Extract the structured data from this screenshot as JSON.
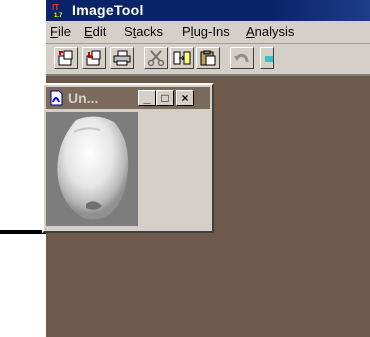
{
  "window": {
    "title": "ImageTool",
    "colors": {
      "titlebar": "#0a246a",
      "workspace": "#6e5a4b",
      "chrome": "#d4d0c8"
    }
  },
  "menu": {
    "items": [
      {
        "label": "File",
        "mnemonic": "F",
        "rest": "ile"
      },
      {
        "label": "Edit",
        "mnemonic": "E",
        "rest": "dit"
      },
      {
        "label": "Stacks",
        "pre": "S",
        "mnemonic": "t",
        "rest": "acks"
      },
      {
        "label": "Plug-Ins",
        "pre": "P",
        "mnemonic": "l",
        "rest": "ug-Ins"
      },
      {
        "label": "Analysis",
        "mnemonic": "A",
        "rest": "nalysis"
      }
    ]
  },
  "toolbar": {
    "buttons": [
      {
        "name": "open-icon"
      },
      {
        "name": "save-icon"
      },
      {
        "name": "print-icon"
      },
      {
        "name": "cut-icon"
      },
      {
        "name": "copy-icon"
      },
      {
        "name": "paste-icon"
      },
      {
        "name": "undo-icon"
      }
    ]
  },
  "child_window": {
    "title": "Un...",
    "controls": {
      "minimize": "_",
      "maximize": "□",
      "close": "×"
    }
  },
  "annotation": {
    "arrow": "arrow pointing right"
  }
}
